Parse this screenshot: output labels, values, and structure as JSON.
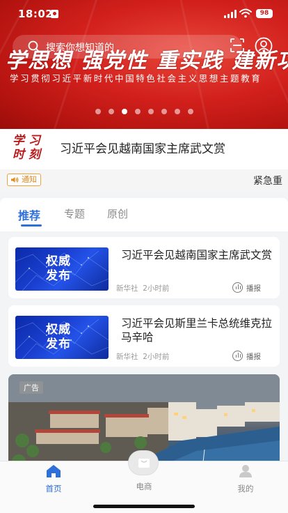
{
  "status": {
    "time": "18:02",
    "battery": "98"
  },
  "search": {
    "placeholder": "搜索你想知道的"
  },
  "banner": {
    "slogan": "学思想 强党性 重实践 建新功",
    "subline": "学习贯彻习近平新时代中国特色社会主义思想主题教育",
    "slide_count": 8,
    "active_slide": 2
  },
  "headline": {
    "logo_line1": "学 习",
    "logo_line2": "时 刻",
    "title": "习近平会见越南国家主席武文赏"
  },
  "notice": {
    "tag": "通知",
    "text": "紧急重"
  },
  "tabs": [
    {
      "label": "推荐"
    },
    {
      "label": "专题"
    },
    {
      "label": "原创"
    }
  ],
  "news": [
    {
      "thumb_line1": "权威",
      "thumb_line2": "发布",
      "title": "习近平会见越南国家主席武文赏",
      "source": "新华社",
      "time": "2小时前",
      "play": "播报"
    },
    {
      "thumb_line1": "权威",
      "thumb_line2": "发布",
      "title": "习近平会见斯里兰卡总统维克拉马辛哈",
      "source": "新华社",
      "time": "2小时前",
      "play": "播报"
    }
  ],
  "ad": {
    "badge": "广告"
  },
  "nav": {
    "home": "首页",
    "mall": "电商",
    "mine": "我的"
  },
  "colors": {
    "brand_red": "#d2201c",
    "accent_blue": "#2f6fd9",
    "notice_orange": "#e08a1e"
  }
}
